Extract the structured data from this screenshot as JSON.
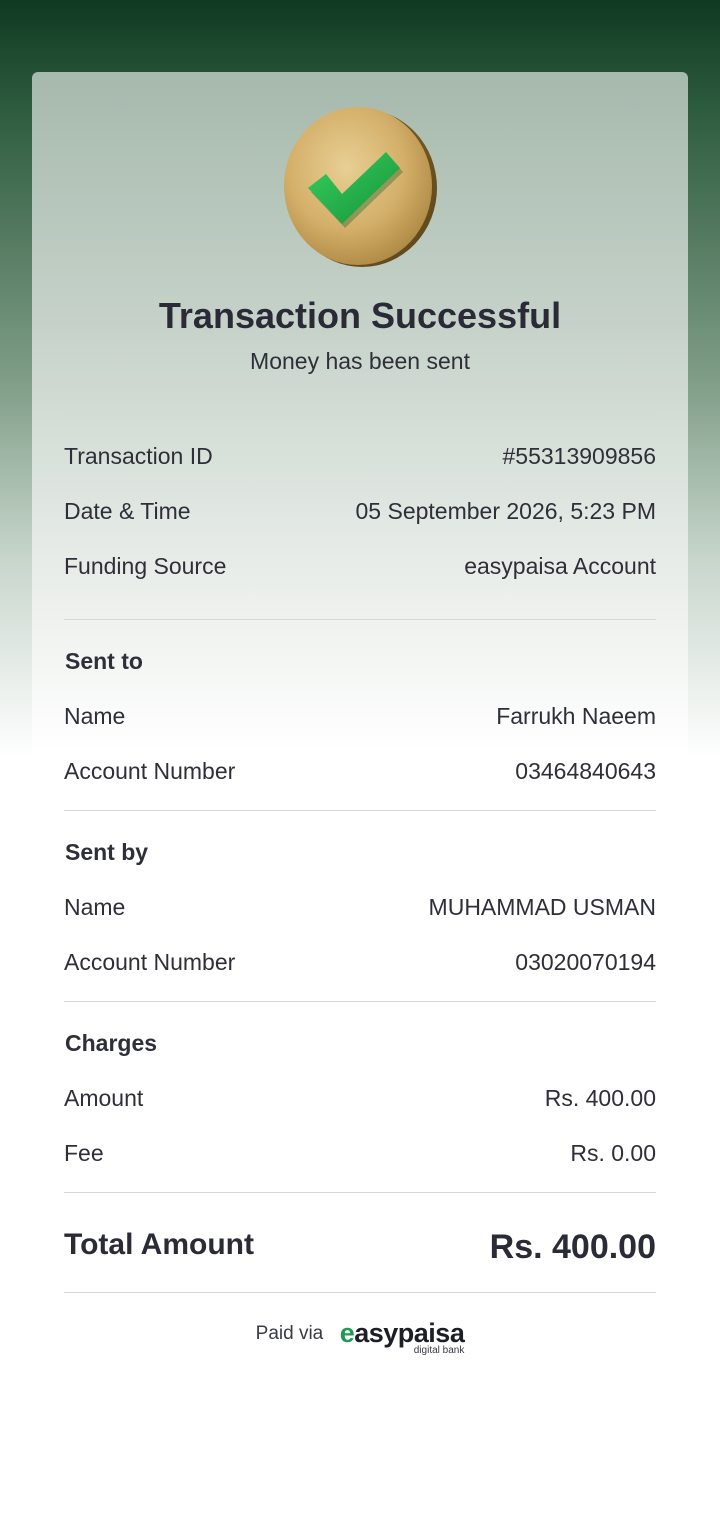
{
  "header": {
    "title": "Transaction Successful",
    "subtitle": "Money has been sent",
    "status_icon": "check-coin-icon"
  },
  "details": [
    {
      "label": "Transaction ID",
      "value": "#55313909856"
    },
    {
      "label": "Date & Time",
      "value": "05 September 2026, 5:23 PM"
    },
    {
      "label": "Funding Source",
      "value": "easypaisa Account"
    }
  ],
  "sent_to": {
    "heading": "Sent to",
    "rows": [
      {
        "label": "Name",
        "value": "Farrukh Naeem"
      },
      {
        "label": "Account Number",
        "value": "03464840643"
      }
    ]
  },
  "sent_by": {
    "heading": "Sent by",
    "rows": [
      {
        "label": "Name",
        "value": "MUHAMMAD USMAN"
      },
      {
        "label": "Account Number",
        "value": "03020070194"
      }
    ]
  },
  "charges": {
    "heading": "Charges",
    "rows": [
      {
        "label": "Amount",
        "value": "Rs. 400.00"
      },
      {
        "label": "Fee",
        "value": "Rs. 0.00"
      }
    ]
  },
  "total": {
    "label": "Total Amount",
    "value": "Rs. 400.00"
  },
  "footer": {
    "paid_via": "Paid via",
    "brand_first": "e",
    "brand_rest": "asypaisa",
    "brand_sub": "digital bank"
  },
  "colors": {
    "brand_green": "#1e9b52",
    "check_green": "#22b24c",
    "coin_gold": "#d4b06a",
    "header_dark_green": "#0f3a22"
  }
}
